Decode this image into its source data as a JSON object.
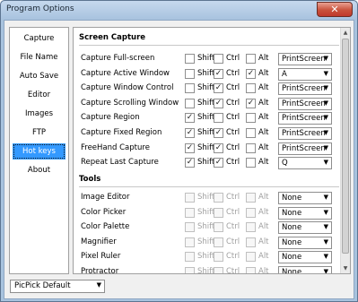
{
  "window": {
    "title": "Program Options",
    "close_glyph": "✕"
  },
  "nav": {
    "items": [
      {
        "label": "Capture"
      },
      {
        "label": "File Name"
      },
      {
        "label": "Auto Save"
      },
      {
        "label": "Editor"
      },
      {
        "label": "Images"
      },
      {
        "label": "FTP"
      },
      {
        "label": "Hot keys",
        "active": true
      },
      {
        "label": "About"
      }
    ]
  },
  "modifiers": {
    "shift": "Shift",
    "ctrl": "Ctrl",
    "alt": "Alt"
  },
  "check_glyph": "✓",
  "sections": {
    "screen_capture": {
      "title": "Screen Capture",
      "rows": [
        {
          "label": "Capture Full-screen",
          "shift": false,
          "ctrl": false,
          "alt": false,
          "key": "PrintScreen"
        },
        {
          "label": "Capture Active Window",
          "shift": false,
          "ctrl": true,
          "alt": true,
          "key": "A"
        },
        {
          "label": "Capture Window Control",
          "shift": false,
          "ctrl": true,
          "alt": false,
          "key": "PrintScreen"
        },
        {
          "label": "Capture Scrolling Window",
          "shift": false,
          "ctrl": true,
          "alt": true,
          "key": "PrintScreen"
        },
        {
          "label": "Capture Region",
          "shift": true,
          "ctrl": false,
          "alt": false,
          "key": "PrintScreen"
        },
        {
          "label": "Capture Fixed Region",
          "shift": true,
          "ctrl": true,
          "alt": false,
          "key": "PrintScreen"
        },
        {
          "label": "FreeHand Capture",
          "shift": true,
          "ctrl": true,
          "alt": false,
          "key": "PrintScreen"
        },
        {
          "label": "Repeat Last Capture",
          "shift": true,
          "ctrl": true,
          "alt": false,
          "key": "Q"
        }
      ]
    },
    "tools": {
      "title": "Tools",
      "rows": [
        {
          "label": "Image Editor",
          "key": "None"
        },
        {
          "label": "Color Picker",
          "key": "None"
        },
        {
          "label": "Color Palette",
          "key": "None"
        },
        {
          "label": "Magnifier",
          "key": "None"
        },
        {
          "label": "Pixel Ruler",
          "key": "None"
        },
        {
          "label": "Protractor",
          "key": "None"
        }
      ]
    }
  },
  "profile_select": {
    "value": "PicPick Default"
  },
  "dropdown_arrow": "▼",
  "scroll_up_glyph": "▲",
  "scroll_down_glyph": "▼"
}
